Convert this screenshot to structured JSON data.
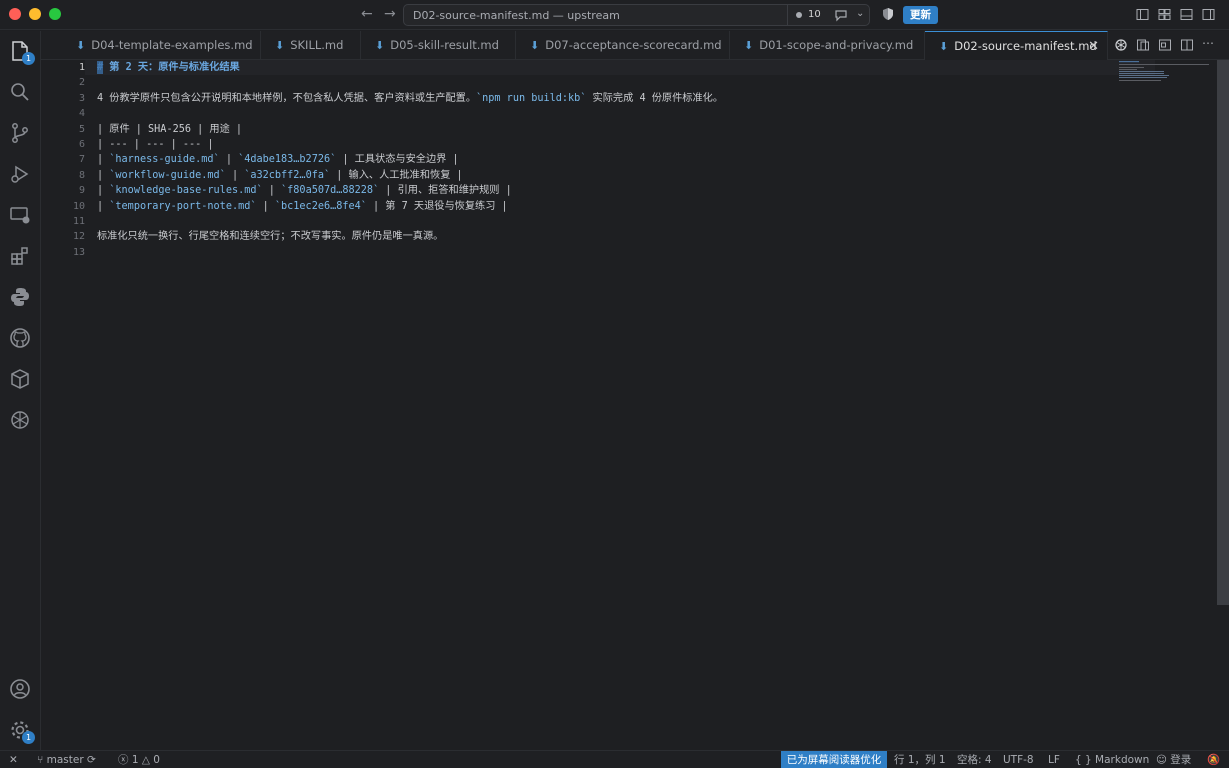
{
  "window": {
    "title": "D02-source-manifest.md — upstream",
    "changes_count": "10",
    "update_label": "更新"
  },
  "activity_bar": {
    "explorer_badge": "1",
    "settings_badge": "1"
  },
  "tabs": [
    {
      "label": "D04-template-examples.md"
    },
    {
      "label": "SKILL.md"
    },
    {
      "label": "D05-skill-result.md"
    },
    {
      "label": "D07-acceptance-scorecard.md"
    },
    {
      "label": "D01-scope-and-privacy.md"
    },
    {
      "label": "D02-source-manifest.md",
      "active": true
    }
  ],
  "editor": {
    "line_numbers": [
      "1",
      "2",
      "3",
      "4",
      "5",
      "6",
      "7",
      "8",
      "9",
      "10",
      "11",
      "12",
      "13"
    ],
    "lines": {
      "l1": "# 第 2 天：原件与标准化结果",
      "l3a": "4 份教学原件只包含公开说明和本地样例，不包含私人凭据、客户资料或生产配置。",
      "l3b": "`npm run build:kb`",
      "l3c": " 实际完成 4 份原件标准化。",
      "l5": "| 原件 | SHA-256 | 用途 |",
      "l6": "| --- | --- | --- |",
      "l7a": "| ",
      "l7b": "`harness-guide.md`",
      "l7c": " | ",
      "l7d": "`4dabe183…b2726`",
      "l7e": " | 工具状态与安全边界 |",
      "l8a": "| ",
      "l8b": "`workflow-guide.md`",
      "l8c": " | ",
      "l8d": "`a32cbff2…0fa`",
      "l8e": " | 输入、人工批准和恢复 |",
      "l9a": "| ",
      "l9b": "`knowledge-base-rules.md`",
      "l9c": " | ",
      "l9d": "`f80a507d…88228`",
      "l9e": " | 引用、拒答和维护规则 |",
      "l10a": "| ",
      "l10b": "`temporary-port-note.md`",
      "l10c": " | ",
      "l10d": "`bc1ec2e6…8fe4`",
      "l10e": " | 第 7 天退役与恢复练习 |",
      "l12": "标准化只统一换行、行尾空格和连续空行；不改写事实。原件仍是唯一真源。"
    }
  },
  "statusbar": {
    "branch": "master",
    "errors": "1",
    "warnings": "0",
    "screen_reader": "已为屏幕阅读器优化",
    "position": "行 1，列 1",
    "spaces": "空格: 4",
    "encoding": "UTF-8",
    "eol": "LF",
    "language": "Markdown",
    "login": "登录"
  },
  "colors": {
    "accent": "#2f7fc6",
    "heading": "#6aa7e0",
    "inline_code": "#7ab8e8"
  }
}
